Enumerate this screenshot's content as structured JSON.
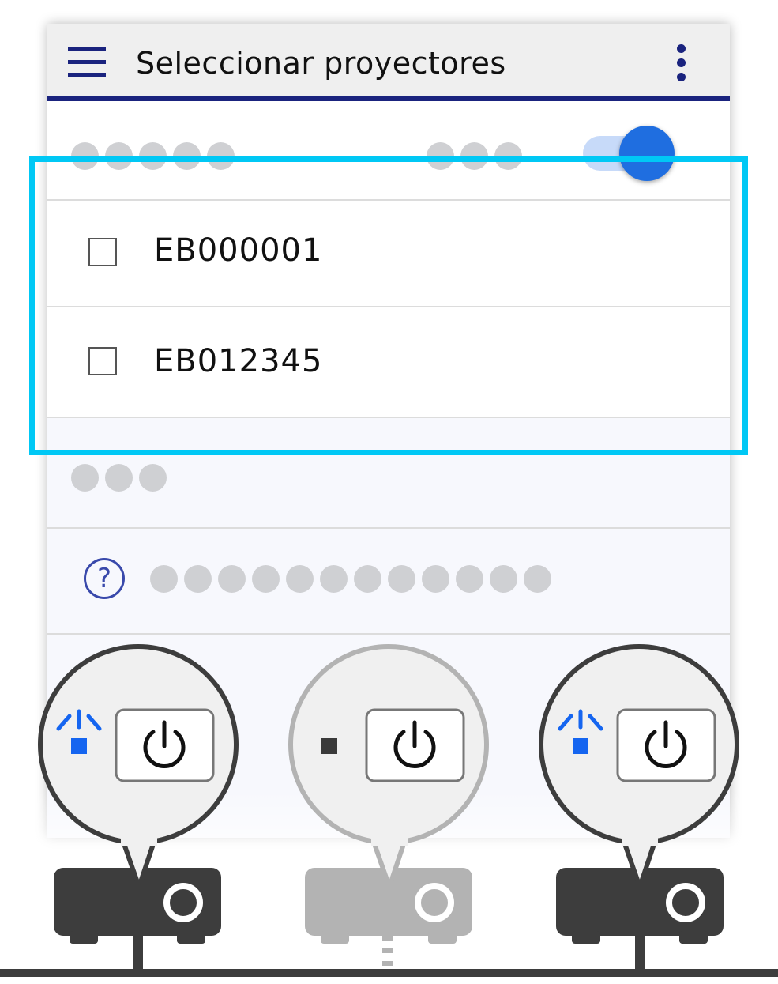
{
  "appbar": {
    "title": "Seleccionar proyectores",
    "menu_icon": "hamburger-menu-icon",
    "more_icon": "more-vert-icon"
  },
  "toggle": {
    "on": true,
    "knob_color": "#1f6ee0",
    "track_color": "#c7daf9"
  },
  "projector_list": [
    {
      "name": "EB000001",
      "checked": false
    },
    {
      "name": "EB012345",
      "checked": false
    }
  ],
  "help": {
    "icon": "help-circle-icon",
    "glyph": "?"
  },
  "illustration": {
    "projectors": [
      {
        "state": "on",
        "indicator_color": "#1565f0",
        "icon": "power-icon"
      },
      {
        "state": "off",
        "indicator_color": "#3a3a3a",
        "icon": "power-icon"
      },
      {
        "state": "on",
        "indicator_color": "#1565f0",
        "icon": "power-icon"
      }
    ]
  },
  "colors": {
    "accent": "#1a237e",
    "highlight": "#00c8f5",
    "projector_dark": "#3d3d3d",
    "projector_off": "#b3b3b3"
  }
}
